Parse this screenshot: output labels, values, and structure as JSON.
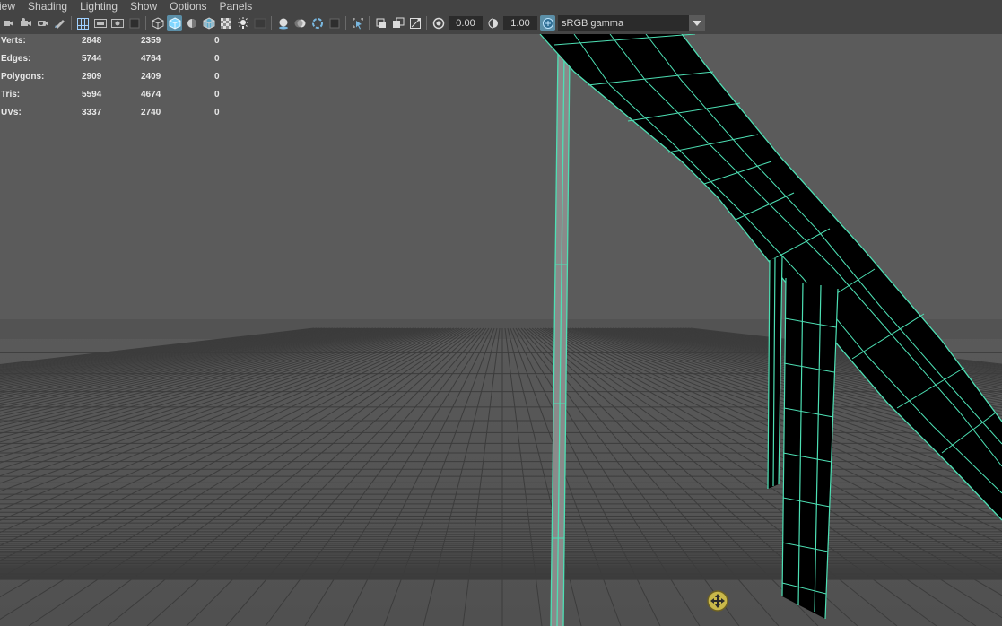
{
  "menu": [
    "iew",
    "Shading",
    "Lighting",
    "Show",
    "Options",
    "Panels"
  ],
  "toolbar": {
    "exposure_value": "0.00",
    "gamma_value": "1.00",
    "color_management": "sRGB gamma"
  },
  "hud": {
    "rows": [
      {
        "label": "Verts:",
        "a": "2848",
        "b": "2359",
        "c": "0"
      },
      {
        "label": "Edges:",
        "a": "5744",
        "b": "4764",
        "c": "0"
      },
      {
        "label": "Polygons:",
        "a": "2909",
        "b": "2409",
        "c": "0"
      },
      {
        "label": "Tris:",
        "a": "5594",
        "b": "4674",
        "c": "0"
      },
      {
        "label": "UVs:",
        "a": "3337",
        "b": "2740",
        "c": "0"
      }
    ]
  },
  "colors": {
    "background_upper": "#5b5b5b",
    "floor": "#4f4f4f",
    "grid": "#3c3c3c",
    "wireframe": "#4de0b4",
    "mesh_fill": "#000000",
    "cursor": "#c9b84a"
  }
}
